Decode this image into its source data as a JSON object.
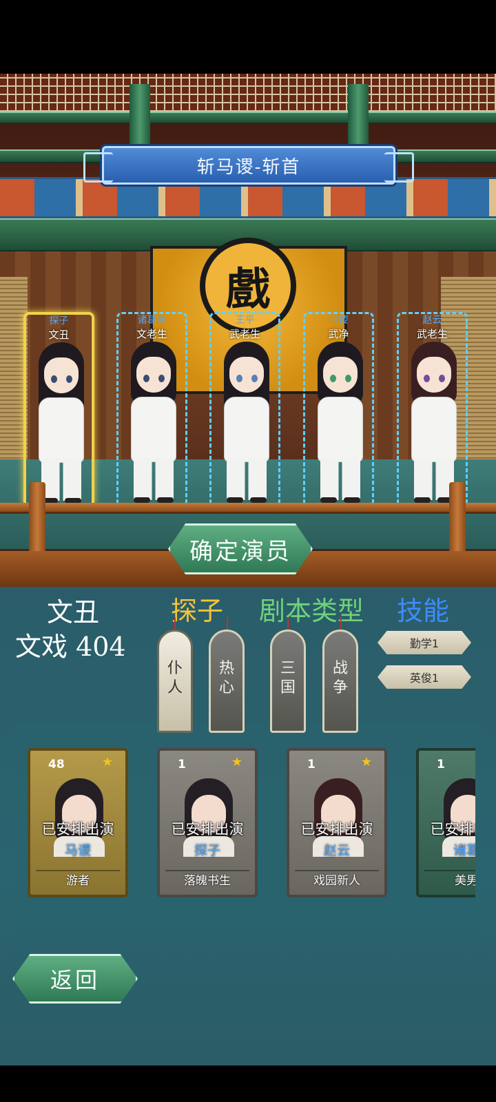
{
  "stage": {
    "title": "斩马谡-斩首",
    "sign_char": "戲",
    "slots": [
      {
        "role": "探子",
        "type": "文丑",
        "selected": true
      },
      {
        "role": "诸葛亮",
        "type": "文老生",
        "selected": false
      },
      {
        "role": "王平",
        "type": "武老生",
        "selected": false
      },
      {
        "role": "马谡",
        "type": "武净",
        "selected": false
      },
      {
        "role": "赵云",
        "type": "武老生",
        "selected": false
      }
    ],
    "confirm_label": "确定演员"
  },
  "detail": {
    "actor_type": "文丑",
    "actor_score": "文戏 404",
    "headers": {
      "role": "探子",
      "script_type": "剧本类型",
      "skill": "技能"
    },
    "role_tags": [
      {
        "text": "仆\n人",
        "style": "light"
      },
      {
        "text": "热\n心",
        "style": "dark"
      }
    ],
    "script_tags": [
      {
        "text": "三\n国",
        "style": "dark"
      },
      {
        "text": "战\n争",
        "style": "dark"
      }
    ],
    "skills": [
      "勤学1",
      "英俊1"
    ]
  },
  "cards": [
    {
      "level": "48",
      "status": "已安排出演",
      "role": "马谡",
      "name": "游者",
      "style": "gold"
    },
    {
      "level": "1",
      "status": "已安排出演",
      "role": "探子",
      "name": "落魄书生",
      "style": "grey"
    },
    {
      "level": "1",
      "status": "已安排出演",
      "role": "赵云",
      "name": "戏园新人",
      "style": "grey"
    },
    {
      "level": "1",
      "status": "已安排出演",
      "role": "诸葛",
      "name": "美男",
      "style": "green"
    }
  ],
  "back_label": "返回",
  "colors": {
    "gold_accent": "#f5c43a",
    "green_accent": "#6fd27a",
    "blue_accent": "#3e8cff",
    "slot_border": "#5fd0ff",
    "selected_border": "#f1d24a"
  }
}
